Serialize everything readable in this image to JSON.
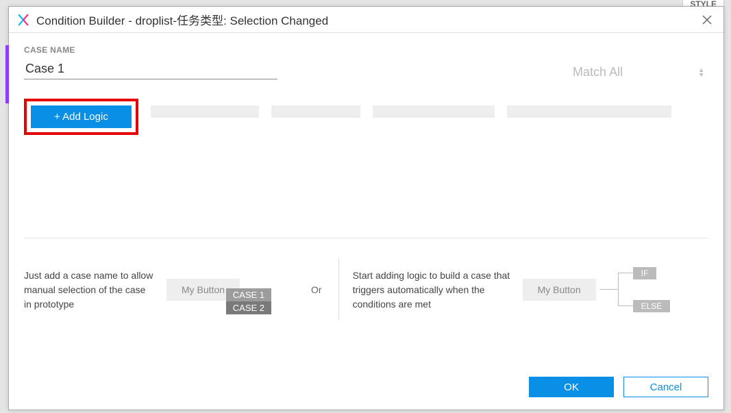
{
  "bg_tab": "STYLE",
  "dialog": {
    "title": "Condition Builder   -   droplist-任务类型: Selection Changed"
  },
  "case": {
    "label": "CASE NAME",
    "value": "Case 1",
    "match_mode": "Match All"
  },
  "logic": {
    "add_button": "+ Add Logic"
  },
  "hints": {
    "left_text": "Just add a case name to allow manual selection of the case in prototype",
    "left_button": "My Button",
    "left_badge1": "CASE 1",
    "left_badge2": "CASE 2",
    "or": "Or",
    "right_text": "Start adding logic to build a case that triggers automatically when the conditions are met",
    "right_button": "My Button",
    "if": "IF",
    "else": "ELSE"
  },
  "footer": {
    "ok": "OK",
    "cancel": "Cancel"
  }
}
